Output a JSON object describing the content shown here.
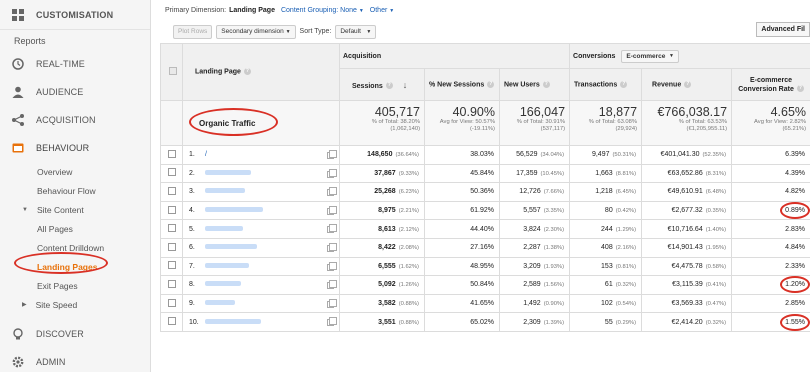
{
  "sidebar": {
    "header": "CUSTOMISATION",
    "reports": "Reports",
    "realtime": "REAL-TIME",
    "audience": "AUDIENCE",
    "acquisition": "ACQUISITION",
    "behaviour": "BEHAVIOUR",
    "overview": "Overview",
    "behaviour_flow": "Behaviour Flow",
    "site_content": "Site Content",
    "all_pages": "All Pages",
    "content_drilldown": "Content Drilldown",
    "landing_pages": "Landing Pages",
    "exit_pages": "Exit Pages",
    "site_speed": "Site Speed",
    "discover": "DISCOVER",
    "admin": "ADMIN",
    "colors": {
      "active": "#e8710a",
      "annotation": "#d93025"
    }
  },
  "dimbar": {
    "label": "Primary Dimension:",
    "primary": "Landing Page",
    "content_grouping": "Content Grouping: None",
    "other": "Other"
  },
  "toolbar": {
    "plot_rows": "Plot Rows",
    "secondary_dimension": "Secondary dimension",
    "sort_type_label": "Sort Type:",
    "sort_type_value": "Default",
    "advanced": "Advanced Fil"
  },
  "table": {
    "landing_page_header": "Landing Page",
    "acquisition_header": "Acquisition",
    "conversions_header": "Conversions",
    "conversions_select": "E-commerce",
    "columns": {
      "sessions": "Sessions",
      "new_sessions": "% New Sessions",
      "new_users": "New Users",
      "transactions": "Transactions",
      "revenue": "Revenue",
      "conv_rate": "E-commerce Conversion Rate"
    },
    "annotation_label": "Organic Traffic",
    "totals": {
      "sessions": "405,717",
      "sessions_sub1": "% of Total: 38.20%",
      "sessions_sub2": "(1,062,140)",
      "new_sessions": "40.90%",
      "new_sessions_sub1": "Avg for View: 50.57%",
      "new_sessions_sub2": "(-19.11%)",
      "new_users": "166,047",
      "new_users_sub1": "% of Total: 30.91%",
      "new_users_sub2": "(537,117)",
      "transactions": "18,877",
      "transactions_sub1": "% of Total: 63.08%",
      "transactions_sub2": "(29,924)",
      "revenue": "€766,038.17",
      "revenue_sub1": "% of Total: 63.53%",
      "revenue_sub2": "(€1,205,955.11)",
      "conv_rate": "4.65%",
      "conv_rate_sub1": "Avg for View: 2.82%",
      "conv_rate_sub2": "(65.21%)"
    },
    "rows": [
      {
        "idx": "1.",
        "page": "/",
        "sessions": "148,650",
        "sessions_pct": "(36.64%)",
        "new_sessions": "38.03%",
        "new_users": "56,529",
        "new_users_pct": "(34.04%)",
        "transactions": "9,497",
        "transactions_pct": "(50.31%)",
        "revenue": "€401,041.30",
        "revenue_pct": "(52.35%)",
        "conv_rate": "6.39%"
      },
      {
        "idx": "2.",
        "page": "",
        "sessions": "37,867",
        "sessions_pct": "(9.33%)",
        "new_sessions": "45.84%",
        "new_users": "17,359",
        "new_users_pct": "(10.45%)",
        "transactions": "1,663",
        "transactions_pct": "(8.81%)",
        "revenue": "€63,652.86",
        "revenue_pct": "(8.31%)",
        "conv_rate": "4.39%"
      },
      {
        "idx": "3.",
        "page": "",
        "sessions": "25,268",
        "sessions_pct": "(6.23%)",
        "new_sessions": "50.36%",
        "new_users": "12,726",
        "new_users_pct": "(7.66%)",
        "transactions": "1,218",
        "transactions_pct": "(6.45%)",
        "revenue": "€49,610.91",
        "revenue_pct": "(6.48%)",
        "conv_rate": "4.82%"
      },
      {
        "idx": "4.",
        "page": "",
        "sessions": "8,975",
        "sessions_pct": "(2.21%)",
        "new_sessions": "61.92%",
        "new_users": "5,557",
        "new_users_pct": "(3.35%)",
        "transactions": "80",
        "transactions_pct": "(0.42%)",
        "revenue": "€2,677.32",
        "revenue_pct": "(0.35%)",
        "conv_rate": "0.89%"
      },
      {
        "idx": "5.",
        "page": "",
        "sessions": "8,613",
        "sessions_pct": "(2.12%)",
        "new_sessions": "44.40%",
        "new_users": "3,824",
        "new_users_pct": "(2.30%)",
        "transactions": "244",
        "transactions_pct": "(1.29%)",
        "revenue": "€10,716.64",
        "revenue_pct": "(1.40%)",
        "conv_rate": "2.83%"
      },
      {
        "idx": "6.",
        "page": "",
        "sessions": "8,422",
        "sessions_pct": "(2.08%)",
        "new_sessions": "27.16%",
        "new_users": "2,287",
        "new_users_pct": "(1.38%)",
        "transactions": "408",
        "transactions_pct": "(2.16%)",
        "revenue": "€14,901.43",
        "revenue_pct": "(1.95%)",
        "conv_rate": "4.84%"
      },
      {
        "idx": "7.",
        "page": "",
        "sessions": "6,555",
        "sessions_pct": "(1.62%)",
        "new_sessions": "48.95%",
        "new_users": "3,209",
        "new_users_pct": "(1.93%)",
        "transactions": "153",
        "transactions_pct": "(0.81%)",
        "revenue": "€4,475.78",
        "revenue_pct": "(0.58%)",
        "conv_rate": "2.33%"
      },
      {
        "idx": "8.",
        "page": "",
        "sessions": "5,092",
        "sessions_pct": "(1.26%)",
        "new_sessions": "50.84%",
        "new_users": "2,589",
        "new_users_pct": "(1.56%)",
        "transactions": "61",
        "transactions_pct": "(0.32%)",
        "revenue": "€3,115.39",
        "revenue_pct": "(0.41%)",
        "conv_rate": "1.20%"
      },
      {
        "idx": "9.",
        "page": "",
        "sessions": "3,582",
        "sessions_pct": "(0.88%)",
        "new_sessions": "41.65%",
        "new_users": "1,492",
        "new_users_pct": "(0.90%)",
        "transactions": "102",
        "transactions_pct": "(0.54%)",
        "revenue": "€3,569.33",
        "revenue_pct": "(0.47%)",
        "conv_rate": "2.85%"
      },
      {
        "idx": "10.",
        "page": "",
        "sessions": "3,551",
        "sessions_pct": "(0.88%)",
        "new_sessions": "65.02%",
        "new_users": "2,309",
        "new_users_pct": "(1.39%)",
        "transactions": "55",
        "transactions_pct": "(0.29%)",
        "revenue": "€2,414.20",
        "revenue_pct": "(0.32%)",
        "conv_rate": "1.55%"
      }
    ]
  }
}
